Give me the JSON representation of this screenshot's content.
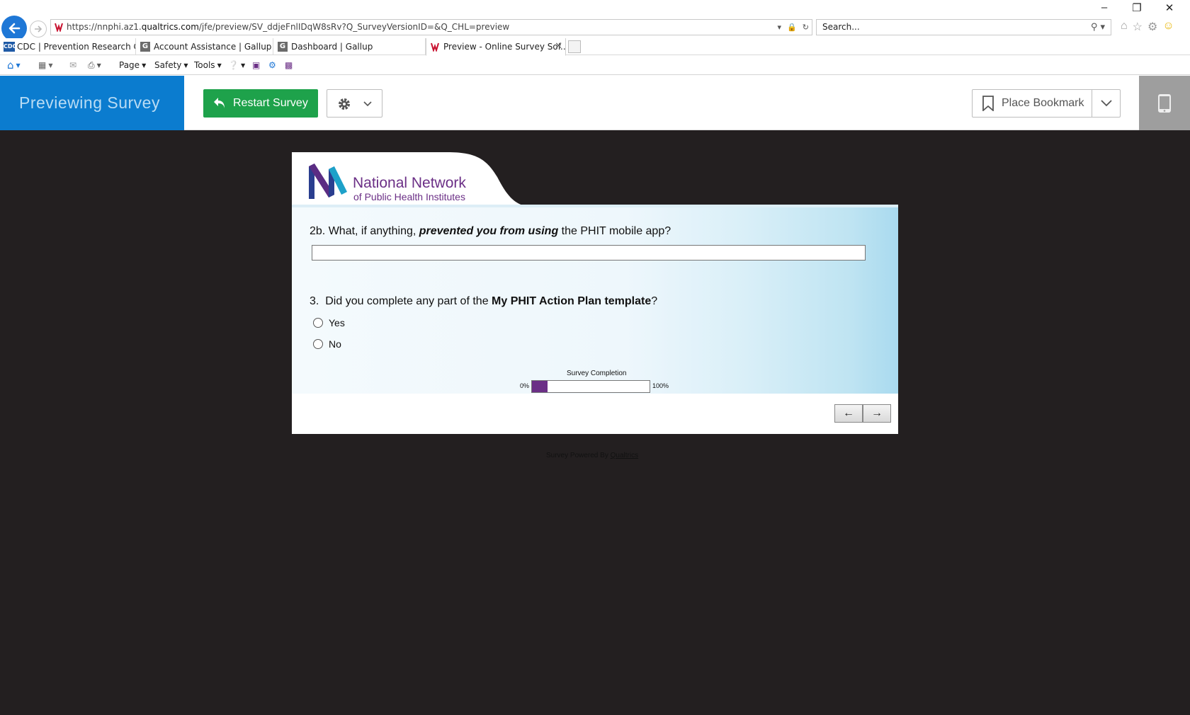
{
  "browser": {
    "url_prefix": "https://nnphi.az1.",
    "url_domain": "qualtrics.com",
    "url_path": "/jfe/preview/SV_ddjeFnlIDqW8sRv?Q_SurveyVersionID=&Q_CHL=preview",
    "search_placeholder": "Search...",
    "tabs": [
      {
        "label": "CDC | Prevention Research Ce...",
        "icon": "CDC"
      },
      {
        "label": "Account Assistance | Gallup",
        "icon": "G"
      },
      {
        "label": "Dashboard | Gallup",
        "icon": "G"
      },
      {
        "label": "Preview - Online Survey Sof...",
        "icon": "qualtrics-icon"
      }
    ],
    "commands": {
      "page": "Page",
      "safety": "Safety",
      "tools": "Tools"
    }
  },
  "header": {
    "title": "Previewing Survey",
    "restart": "Restart Survey",
    "bookmark": "Place Bookmark"
  },
  "logo": {
    "line1": "National Network",
    "line2": "of Public Health Institutes",
    "color": "#6b2f86"
  },
  "questions": {
    "q2b": {
      "prefix": "2b. What, if anything, ",
      "emphasis": "prevented you from using",
      "suffix": " the PHIT mobile app?"
    },
    "q3": {
      "prefix": "3.  Did you complete any part of the ",
      "emphasis": "My PHIT Action Plan template",
      "suffix": "?",
      "options": [
        "Yes",
        "No"
      ]
    }
  },
  "progress": {
    "label": "Survey Completion",
    "min": "0%",
    "max": "100%",
    "value": 0.13
  },
  "nav": {
    "prev": "←",
    "next": "→"
  },
  "footer": {
    "prefix": "Survey Powered By ",
    "link": "Qualtrics"
  },
  "colors": {
    "accent_blue": "#0b7ccf",
    "restart_green": "#1ea24b",
    "brand_purple": "#6b2f86"
  }
}
